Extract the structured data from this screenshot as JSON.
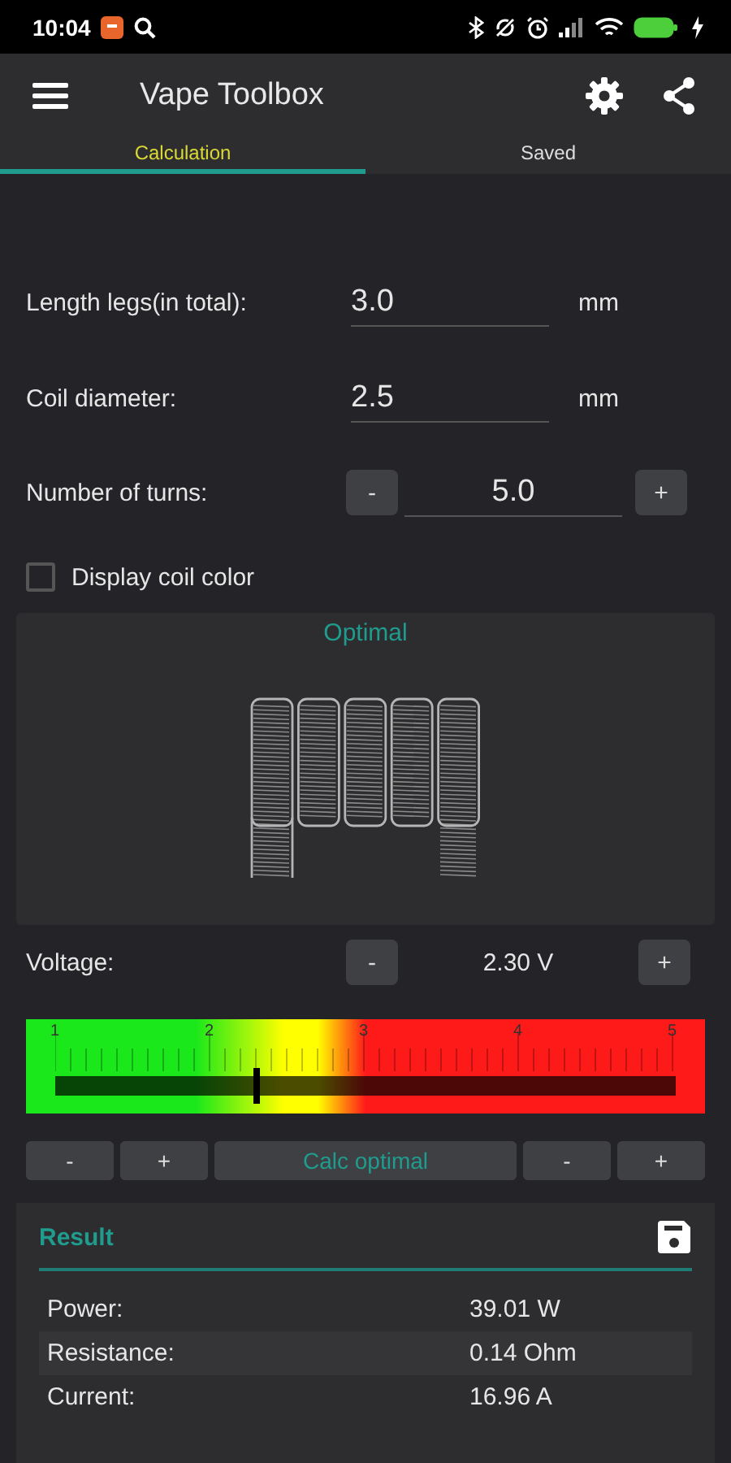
{
  "status_bar": {
    "time": "10:04"
  },
  "app_bar": {
    "title": "Vape Toolbox"
  },
  "tabs": [
    {
      "label": "Calculation",
      "selected": true
    },
    {
      "label": "Saved",
      "selected": false
    }
  ],
  "fields": [
    {
      "label": "Length legs(in total):",
      "value": "3.0",
      "unit": "mm"
    },
    {
      "label": "Coil diameter:",
      "value": "2.5",
      "unit": "mm"
    }
  ],
  "turns": {
    "label": "Number of turns:",
    "value": "5.0",
    "minus": "-",
    "plus": "+"
  },
  "coil_color": {
    "label": "Display coil color",
    "checked": false
  },
  "coil_preview": {
    "status": "Optimal"
  },
  "voltage": {
    "label": "Voltage:",
    "value": "2.30 V",
    "minus": "-",
    "plus": "+",
    "level": 0.325,
    "scale": [
      "1",
      "2",
      "3",
      "4",
      "5"
    ]
  },
  "adjust_buttons": [
    {
      "label": "-",
      "kind": "step"
    },
    {
      "label": "+",
      "kind": "step"
    },
    {
      "label": "Calc optimal",
      "kind": "action"
    },
    {
      "label": "-",
      "kind": "step"
    },
    {
      "label": "+",
      "kind": "step"
    }
  ],
  "result": {
    "title": "Result",
    "rows": [
      {
        "label": "Power:",
        "value": "39.01 W"
      },
      {
        "label": "Resistance:",
        "value": "0.14 Ohm"
      },
      {
        "label": "Current:",
        "value": "16.96 A"
      }
    ]
  }
}
